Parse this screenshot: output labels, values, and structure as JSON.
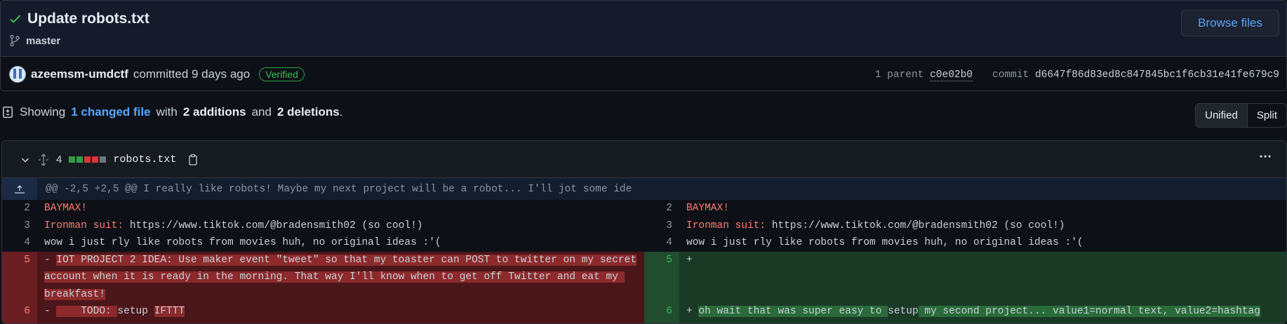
{
  "commit": {
    "title": "Update robots.txt",
    "branch": "master",
    "browse_label": "Browse files",
    "author": "azeemsm-umdctf",
    "committed_text": "committed 9 days ago",
    "verified_label": "Verified",
    "parent_label": "1 parent",
    "parent_sha": "c0e02b0",
    "commit_label": "commit",
    "commit_sha": "d6647f86d83ed8c847845bc1f6cb31e41fe679c9"
  },
  "summary": {
    "showing": "Showing",
    "changed_link": "1 changed file",
    "with": "with",
    "additions": "2 additions",
    "and": "and",
    "deletions": "2 deletions",
    "period": "."
  },
  "view_toggle": {
    "unified": "Unified",
    "split": "Split",
    "active": "Unified"
  },
  "file": {
    "change_count": "4",
    "name": "robots.txt",
    "diffstat_colors": [
      "#2ea043",
      "#2ea043",
      "#da3633",
      "#da3633",
      "#6e7681"
    ]
  },
  "hunk_header": "@@ -2,5 +2,5 @@ I really like robots! Maybe my next project will be a robot... I'll jot some ide",
  "left_lines": {
    "l2": {
      "num": "2",
      "text": "BAYMAX!"
    },
    "l3": {
      "num": "3",
      "prefix": "Ironman suit:",
      "text": " https://www.tiktok.com/@bradensmith02 (so cool!)"
    },
    "l4": {
      "num": "4",
      "text": "wow i just rly like robots from movies huh, no original ideas :'("
    },
    "l5": {
      "num": "5",
      "marker": "-",
      "line1": "IOT PROJECT 2 IDEA: Use maker event \"tweet\" so that my toaster can POST to twitter on my secret",
      "line2": "account when it is ready in the morning. That way I'll know when to get off Twitter and eat my ",
      "line3": "breakfast!"
    },
    "l6": {
      "num": "6",
      "marker": "-",
      "seg1": "    TODO: ",
      "seg2": "setup",
      "seg3": " ",
      "seg4": "IFTTT"
    }
  },
  "right_lines": {
    "r2": {
      "num": "2",
      "text": "BAYMAX!"
    },
    "r3": {
      "num": "3",
      "prefix": "Ironman suit:",
      "text": " https://www.tiktok.com/@bradensmith02 (so cool!)"
    },
    "r4": {
      "num": "4",
      "text": "wow i just rly like robots from movies huh, no original ideas :'("
    },
    "r5": {
      "num": "5",
      "marker": "+"
    },
    "r6": {
      "num": "6",
      "marker": "+",
      "seg1": "oh wait that was super easy to ",
      "seg2": "setup",
      "seg3": " my second project... value1=normal text, value2=hashtag"
    }
  }
}
